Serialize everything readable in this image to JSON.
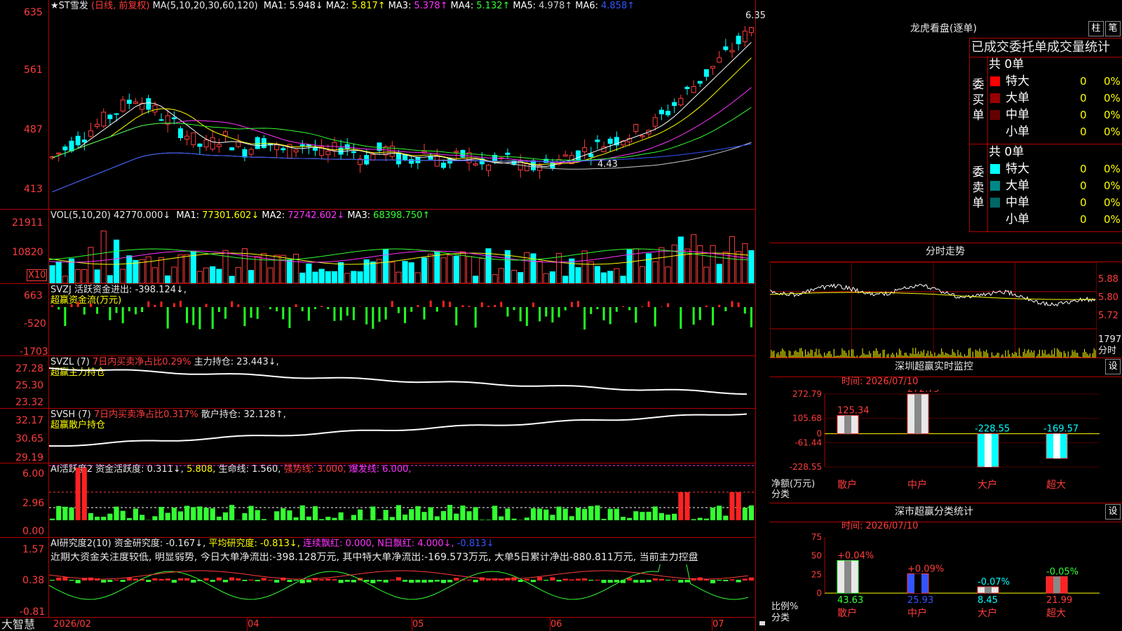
{
  "kline": {
    "title": "★ST雪发",
    "mode": "(日线, 前复权)",
    "ma_label": "MA(5,10,20,30,60,120)",
    "ma": [
      {
        "name": "MA1:",
        "value": "5.948↓",
        "color": "#ffffff"
      },
      {
        "name": "MA2:",
        "value": "5.817↑",
        "color": "#ffff00"
      },
      {
        "name": "MA3:",
        "value": "5.378↑",
        "color": "#ff33ff"
      },
      {
        "name": "MA4:",
        "value": "5.132↑",
        "color": "#33ff33"
      },
      {
        "name": "MA5:",
        "value": "4.978↑",
        "color": "#cccccc"
      },
      {
        "name": "MA6:",
        "value": "4.858↑",
        "color": "#3355ff"
      }
    ],
    "y_ticks": [
      "635",
      "561",
      "487",
      "413"
    ],
    "high_label": "6.35",
    "low_label": "4.43"
  },
  "vol": {
    "label": "VOL(5,10,20)",
    "value": "42770.000↓",
    "ma": [
      {
        "name": "MA1:",
        "value": "77301.602↓",
        "color": "#ffff00"
      },
      {
        "name": "MA2:",
        "value": "72742.602↓",
        "color": "#ff33ff"
      },
      {
        "name": "MA3:",
        "value": "68398.750↑",
        "color": "#33ff33"
      }
    ],
    "y_ticks": [
      "21911",
      "10820"
    ],
    "unit": "X10"
  },
  "svzj": {
    "label": "SVZJ",
    "desc": "活跃资金进出:",
    "value": "-398.124↓,",
    "sub": "超赢资金流(万元)",
    "y_ticks": [
      "663",
      "-520",
      "-1703"
    ]
  },
  "svzl": {
    "label": "SVZL (7)",
    "desc": "7日内买卖净占比0.29%",
    "key": "主力持仓:",
    "value": "23.443↓,",
    "sub": "超赢主力持仓",
    "y_ticks": [
      "27.28",
      "25.30",
      "23.32"
    ]
  },
  "svsh": {
    "label": "SVSH (7)",
    "desc": "7日内买卖净占比0.317%",
    "key": "散户持仓:",
    "value": "32.128↑,",
    "sub": "超赢散户持仓",
    "y_ticks": [
      "32.17",
      "30.65",
      "29.19"
    ]
  },
  "ai1": {
    "label": "AI活跃度2",
    "k1": "资金活跃度:",
    "v1": "0.311↓,",
    "v2": "5.808,",
    "k3": "生命线:",
    "v3": "1.560,",
    "k4": "强势线:",
    "v4": "3.000,",
    "k5": "爆发线:",
    "v5": "6.000,",
    "y_ticks": [
      "6.00",
      "2.96",
      "0.00"
    ]
  },
  "ai2": {
    "label": "AI研究度2(10)",
    "k1": "资金研究度:",
    "v1": "-0.167↓,",
    "k2": "平均研究度:",
    "v2": "-0.813↓,",
    "k3": "连续飘红:",
    "v3": "0.000,",
    "k4": "N日飘红:",
    "v4": "4.000↓,",
    "v5": "-0.813↓",
    "text": "近期大资金关注度较低, 明显弱势, 今日大单净流出:-398.128万元, 其中特大单净流出:-169.573万元, 大单5日累计净出-880.811万元, 当前主力控盘",
    "y_ticks": [
      "1.57",
      "0.38",
      "-0.81"
    ]
  },
  "xaxis": {
    "labels": [
      "2026/02",
      "04",
      "05",
      "06",
      "07"
    ]
  },
  "brand": "大智慧",
  "lhb": {
    "title": "龙虎看盘(逐单)",
    "btn1": "柱",
    "btn2": "笔",
    "tabs": "已成交委托单成交量统计",
    "buy_label": "委买单",
    "sell_label": "委卖单",
    "buy_total": "共 0单",
    "sell_total": "共 0单",
    "buy_rows": [
      {
        "name": "特大",
        "n": "0",
        "p": "0%",
        "color": "#ff0000"
      },
      {
        "name": "大单",
        "n": "0",
        "p": "0%",
        "color": "#990000"
      },
      {
        "name": "中单",
        "n": "0",
        "p": "0%",
        "color": "#660000"
      },
      {
        "name": "小单",
        "n": "0",
        "p": "0%",
        "color": "#000000"
      }
    ],
    "sell_rows": [
      {
        "name": "特大",
        "n": "0",
        "p": "0%",
        "color": "#00ffff"
      },
      {
        "name": "大单",
        "n": "0",
        "p": "0%",
        "color": "#008888"
      },
      {
        "name": "中单",
        "n": "0",
        "p": "0%",
        "color": "#006666"
      },
      {
        "name": "小单",
        "n": "0",
        "p": "0%",
        "color": "#000000"
      }
    ]
  },
  "fenshi": {
    "title": "分时走势",
    "y_ticks": [
      "5.88",
      "5.80",
      "5.72"
    ],
    "vol_tick": "1797",
    "vol_label": "分时"
  },
  "monitor": {
    "title": "深圳超赢实时监控",
    "btn": "设",
    "time": "时间: 2026/07/10",
    "y_ticks": [
      "272.79",
      "105.68",
      "0",
      "-61.44",
      "-228.55"
    ],
    "ylabel": "净额(万元)",
    "xlabel": "分类",
    "chart_data": {
      "type": "bar",
      "categories": [
        "散户",
        "中户",
        "大户",
        "超大"
      ],
      "values": [
        125.34,
        272.79,
        -228.55,
        -169.57
      ],
      "labels": [
        "125.34",
        "272.79",
        "-228.55",
        "-169.57"
      ],
      "ylim": [
        -228.55,
        272.79
      ]
    }
  },
  "stats": {
    "title": "深市超赢分类统计",
    "btn": "设",
    "time": "时间: 2026/07/10",
    "y_ticks": [
      "75",
      "50",
      "25",
      "0"
    ],
    "ylabel": "比例%",
    "xlabel": "分类",
    "chart_data": {
      "type": "bar",
      "categories": [
        "散户",
        "中户",
        "大户",
        "超大"
      ],
      "values": [
        43.63,
        25.93,
        8.45,
        21.99
      ],
      "labels": [
        "43.63",
        "25.93",
        "8.45",
        "21.99"
      ],
      "changes": [
        "+0.04%",
        "+0.09%",
        "-0.07%",
        "-0.05%"
      ],
      "ylim": [
        0,
        75
      ]
    }
  }
}
